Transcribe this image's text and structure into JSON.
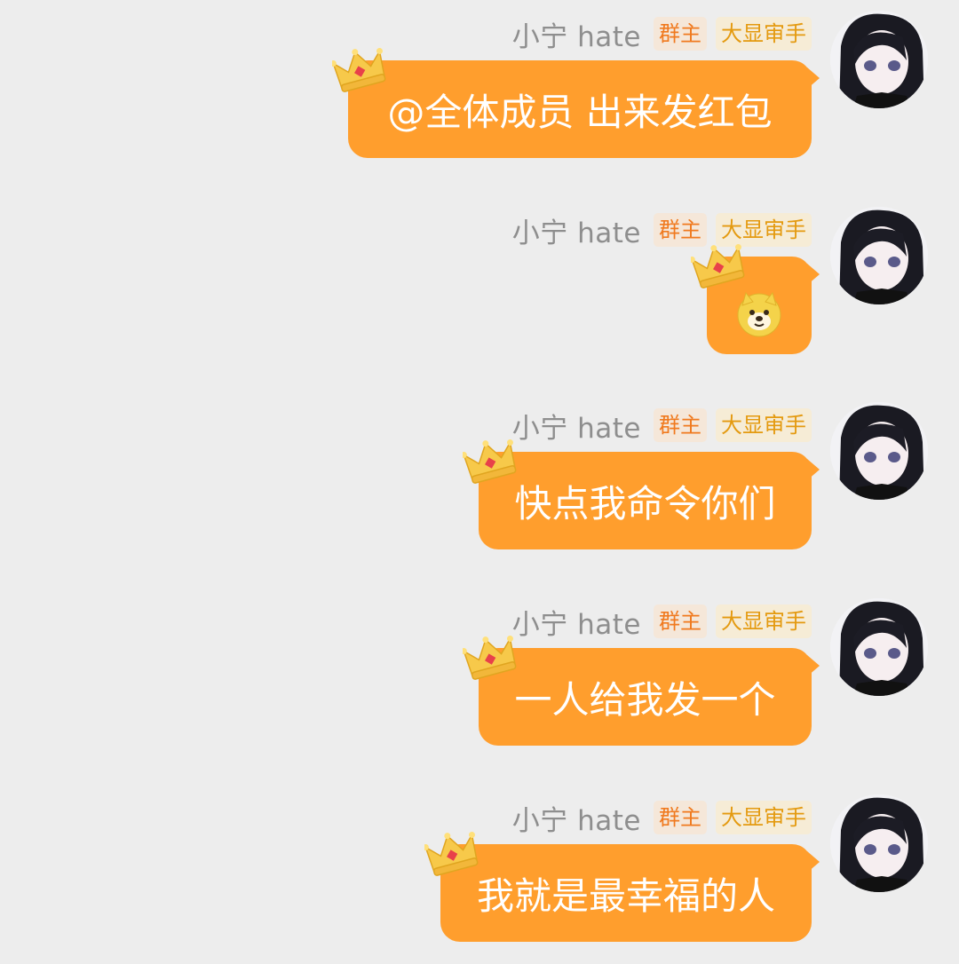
{
  "messages": [
    {
      "sender": "小宁 hate",
      "badge_owner": "群主",
      "badge_title": "大显审手",
      "text": "@全体成员 出来发红包"
    },
    {
      "sender": "小宁 hate",
      "badge_owner": "群主",
      "badge_title": "大显审手",
      "text": "",
      "emoji": "doge-emoji"
    },
    {
      "sender": "小宁 hate",
      "badge_owner": "群主",
      "badge_title": "大显审手",
      "text": "快点我命令你们"
    },
    {
      "sender": "小宁 hate",
      "badge_owner": "群主",
      "badge_title": "大显审手",
      "text": "一人给我发一个"
    },
    {
      "sender": "小宁 hate",
      "badge_owner": "群主",
      "badge_title": "大显审手",
      "text": "我就是最幸福的人"
    }
  ],
  "colors": {
    "bubble": "#ff9e2d",
    "background": "#ededed",
    "owner_badge": "#f07a1f",
    "title_badge": "#e49a10"
  }
}
